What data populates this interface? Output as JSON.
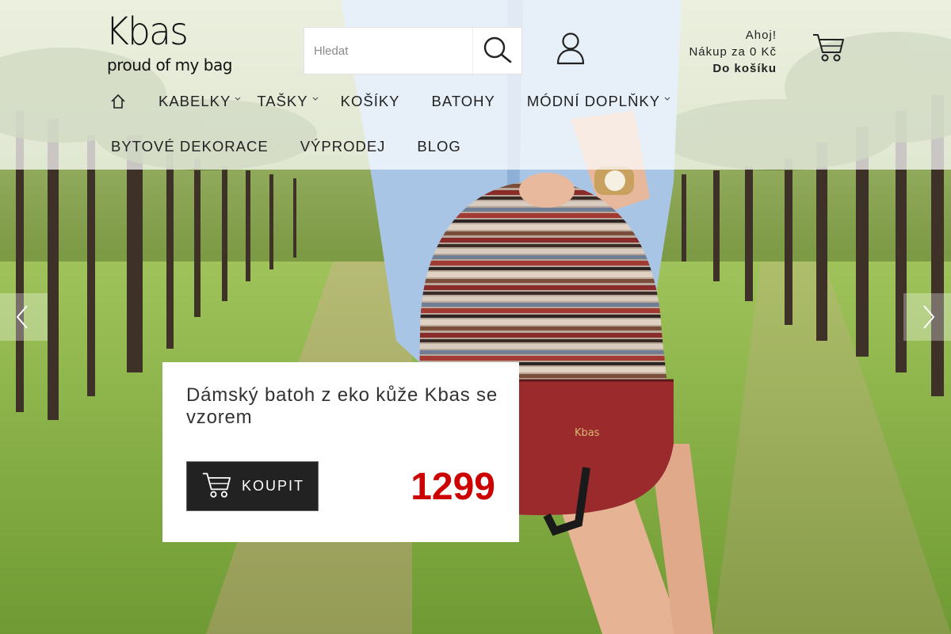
{
  "brand": {
    "logo_text": "Kbas",
    "tagline": "proud of my bag"
  },
  "search": {
    "placeholder": "Hledat"
  },
  "cart": {
    "greeting": "Ahoj!",
    "total_text": "Nákup za 0 Kč",
    "go_to_cart": "Do košíku"
  },
  "nav": {
    "row1": [
      {
        "label": "KABELKY",
        "has_dropdown": true
      },
      {
        "label": "TAŠKY",
        "has_dropdown": true
      },
      {
        "label": "KOŠÍKY",
        "has_dropdown": false
      },
      {
        "label": "BATOHY",
        "has_dropdown": false
      },
      {
        "label": "MÓDNÍ DOPLŇKY",
        "has_dropdown": true
      }
    ],
    "row2": [
      {
        "label": "BYTOVÉ DEKORACE"
      },
      {
        "label": "VÝPRODEJ"
      },
      {
        "label": "BLOG"
      }
    ]
  },
  "hero": {
    "product_title": "Dámský batoh z eko kůže Kbas se vzorem",
    "buy_label": "KOUPIT",
    "price": "1299",
    "bag_logo": "Kbas"
  },
  "icons": {
    "home": "home-icon",
    "search": "search-icon",
    "user": "user-icon",
    "cart": "cart-icon",
    "prev": "chevron-left-icon",
    "next": "chevron-right-icon"
  },
  "colors": {
    "price": "#cc0000",
    "button": "#222222",
    "header_overlay": "rgba(255,255,255,0.72)"
  }
}
